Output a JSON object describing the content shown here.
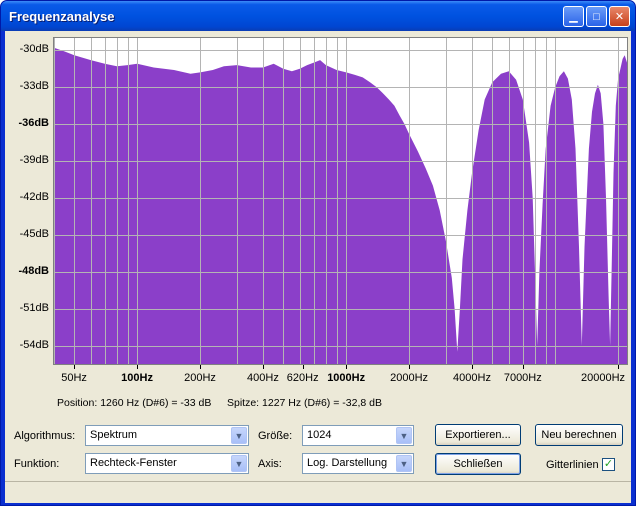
{
  "window": {
    "title": "Frequenzanalyse",
    "min_glyph": "▁",
    "max_glyph": "□",
    "close_glyph": "✕"
  },
  "chart_data": {
    "type": "area",
    "ylabels": [
      "-30dB",
      "-33dB",
      "-36dB",
      "-39dB",
      "-42dB",
      "-45dB",
      "-48dB",
      "-51dB",
      "-54dB"
    ],
    "ylabels_bold": [
      false,
      false,
      true,
      false,
      false,
      false,
      true,
      false,
      false
    ],
    "xlabels": [
      "50Hz",
      "100Hz",
      "200Hz",
      "400Hz",
      "620Hz",
      "1000Hz",
      "2000Hz",
      "4000Hz",
      "7000Hz",
      "20000Hz"
    ],
    "xlabels_bold": [
      false,
      true,
      false,
      false,
      false,
      true,
      false,
      false,
      false,
      false
    ],
    "xlim": [
      40,
      22050
    ],
    "ylim": [
      -55.5,
      -29
    ],
    "x_scale": "log",
    "grid": true,
    "fill_color": "#8b3fc9",
    "points": [
      [
        40,
        -29.8
      ],
      [
        45,
        -30.1
      ],
      [
        50,
        -30.4
      ],
      [
        60,
        -30.8
      ],
      [
        70,
        -31.1
      ],
      [
        80,
        -31.3
      ],
      [
        90,
        -31.2
      ],
      [
        100,
        -31.1
      ],
      [
        120,
        -31.4
      ],
      [
        150,
        -31.6
      ],
      [
        180,
        -31.9
      ],
      [
        200,
        -31.8
      ],
      [
        230,
        -31.6
      ],
      [
        260,
        -31.3
      ],
      [
        300,
        -31.2
      ],
      [
        350,
        -31.4
      ],
      [
        400,
        -31.4
      ],
      [
        450,
        -31.1
      ],
      [
        500,
        -31.5
      ],
      [
        550,
        -31.7
      ],
      [
        600,
        -31.5
      ],
      [
        650,
        -31.2
      ],
      [
        700,
        -31.0
      ],
      [
        750,
        -30.8
      ],
      [
        800,
        -31.2
      ],
      [
        900,
        -31.6
      ],
      [
        1000,
        -31.8
      ],
      [
        1100,
        -32.0
      ],
      [
        1200,
        -32.2
      ],
      [
        1300,
        -32.6
      ],
      [
        1400,
        -33.0
      ],
      [
        1500,
        -33.5
      ],
      [
        1600,
        -34.0
      ],
      [
        1700,
        -34.5
      ],
      [
        1800,
        -35.3
      ],
      [
        1900,
        -36.0
      ],
      [
        2000,
        -36.8
      ],
      [
        2200,
        -38.2
      ],
      [
        2400,
        -39.6
      ],
      [
        2600,
        -41.0
      ],
      [
        2800,
        -43.0
      ],
      [
        3000,
        -45.5
      ],
      [
        3200,
        -48.5
      ],
      [
        3300,
        -51.0
      ],
      [
        3400,
        -54.5
      ],
      [
        3500,
        -51.0
      ],
      [
        3600,
        -47.0
      ],
      [
        3800,
        -43.0
      ],
      [
        4000,
        -40.0
      ],
      [
        4300,
        -36.5
      ],
      [
        4600,
        -34.0
      ],
      [
        5000,
        -32.6
      ],
      [
        5500,
        -31.9
      ],
      [
        6000,
        -31.7
      ],
      [
        6500,
        -32.4
      ],
      [
        7000,
        -34.0
      ],
      [
        7500,
        -37.5
      ],
      [
        7800,
        -42.0
      ],
      [
        8000,
        -48.0
      ],
      [
        8200,
        -54.0
      ],
      [
        8400,
        -48.0
      ],
      [
        8700,
        -42.5
      ],
      [
        9000,
        -38.0
      ],
      [
        9500,
        -34.5
      ],
      [
        10000,
        -33.0
      ],
      [
        10500,
        -32.1
      ],
      [
        11000,
        -31.7
      ],
      [
        11500,
        -32.3
      ],
      [
        12000,
        -34.0
      ],
      [
        12500,
        -38.0
      ],
      [
        13000,
        -46.0
      ],
      [
        13400,
        -54.0
      ],
      [
        13800,
        -46.0
      ],
      [
        14500,
        -38.0
      ],
      [
        15000,
        -35.0
      ],
      [
        15500,
        -33.5
      ],
      [
        16000,
        -32.8
      ],
      [
        16500,
        -33.5
      ],
      [
        17000,
        -36.0
      ],
      [
        17500,
        -42.0
      ],
      [
        18000,
        -50.0
      ],
      [
        18300,
        -54.0
      ],
      [
        18600,
        -48.0
      ],
      [
        19000,
        -40.0
      ],
      [
        19500,
        -34.5
      ],
      [
        20000,
        -32.3
      ],
      [
        20500,
        -31.5
      ],
      [
        21000,
        -30.7
      ],
      [
        21500,
        -30.4
      ],
      [
        22050,
        -31.0
      ]
    ]
  },
  "status": {
    "position": "Position: 1260 Hz (D#6) = -33 dB",
    "peak": "Spitze: 1227 Hz (D#6) = -32,8 dB"
  },
  "controls": {
    "algorithm_label": "Algorithmus:",
    "algorithm_value": "Spektrum",
    "size_label": "Größe:",
    "size_value": "1024",
    "function_label": "Funktion:",
    "function_value": "Rechteck-Fenster",
    "axis_label": "Axis:",
    "axis_value": "Log. Darstellung",
    "export_label": "Exportieren...",
    "recalc_label": "Neu berechnen",
    "close_label": "Schließen",
    "gridlines_label": "Gitterlinien",
    "gridlines_checked": true,
    "dropdown_glyph": "▼",
    "check_glyph": "✓"
  }
}
